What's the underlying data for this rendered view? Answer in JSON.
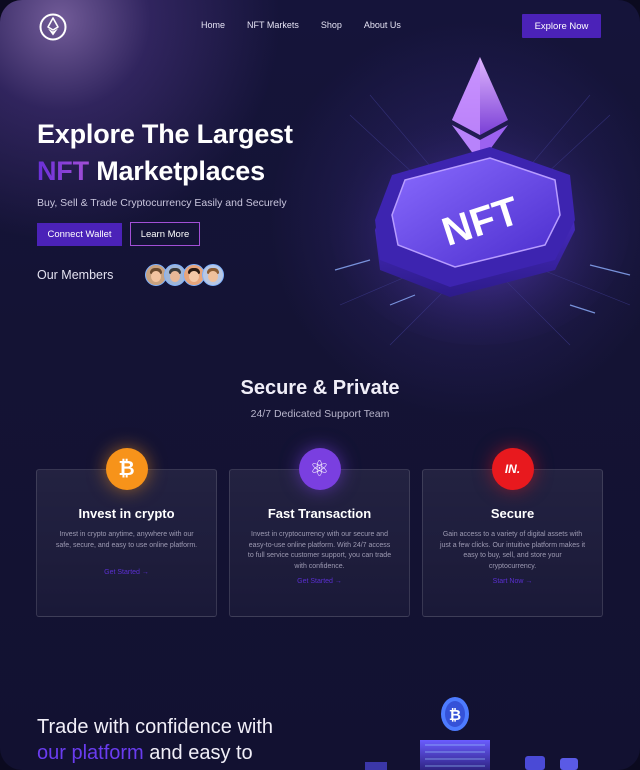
{
  "nav": {
    "links": [
      "Home",
      "NFT Markets",
      "Shop",
      "About Us"
    ],
    "cta": "Explore Now"
  },
  "hero": {
    "title_line1": "Explore The Largest",
    "title_accent": "NFT",
    "title_line2_rest": " Marketplaces",
    "subtitle": "Buy, Sell & Trade Cryptocurrency Easily and Securely",
    "connect_label": "Connect Wallet",
    "learn_label": "Learn More",
    "members_label": "Our Members",
    "art_label": "NFT"
  },
  "features": {
    "title": "Secure & Private",
    "subtitle": "24/7 Dedicated Support Team",
    "cards": [
      {
        "icon": "bitcoin-icon",
        "icon_text": "₿",
        "title": "Invest in crypto",
        "desc": "Invest in crypto anytime, anywhere with our safe, secure, and easy to use online platform.",
        "link": "Get Started →"
      },
      {
        "icon": "atom-icon",
        "icon_text": "⚛",
        "title": "Fast Transaction",
        "desc": "Invest in cryptocurrency with our secure and easy-to-use online platform. With 24/7 access to full service customer support, you can trade with confidence.",
        "link": "Get Started →"
      },
      {
        "icon": "secure-logo-icon",
        "icon_text": "IN.",
        "title": "Secure",
        "desc": "Gain access to a variety of digital assets with just a few clicks. Our intuitive platform makes it easy to buy, sell, and store your cryptocurrency.",
        "link": "Start Now →"
      }
    ]
  },
  "bottom": {
    "line1": "Trade with confidence with",
    "accent": "our platform",
    "line2_rest": "  and easy to",
    "art_coin": "₿"
  },
  "colors": {
    "brand_purple": "#4b22b8",
    "accent_magenta": "#a24fd6",
    "bitcoin_orange": "#f7931a",
    "atom_purple": "#7a3fe0",
    "secure_red": "#e8191e"
  }
}
